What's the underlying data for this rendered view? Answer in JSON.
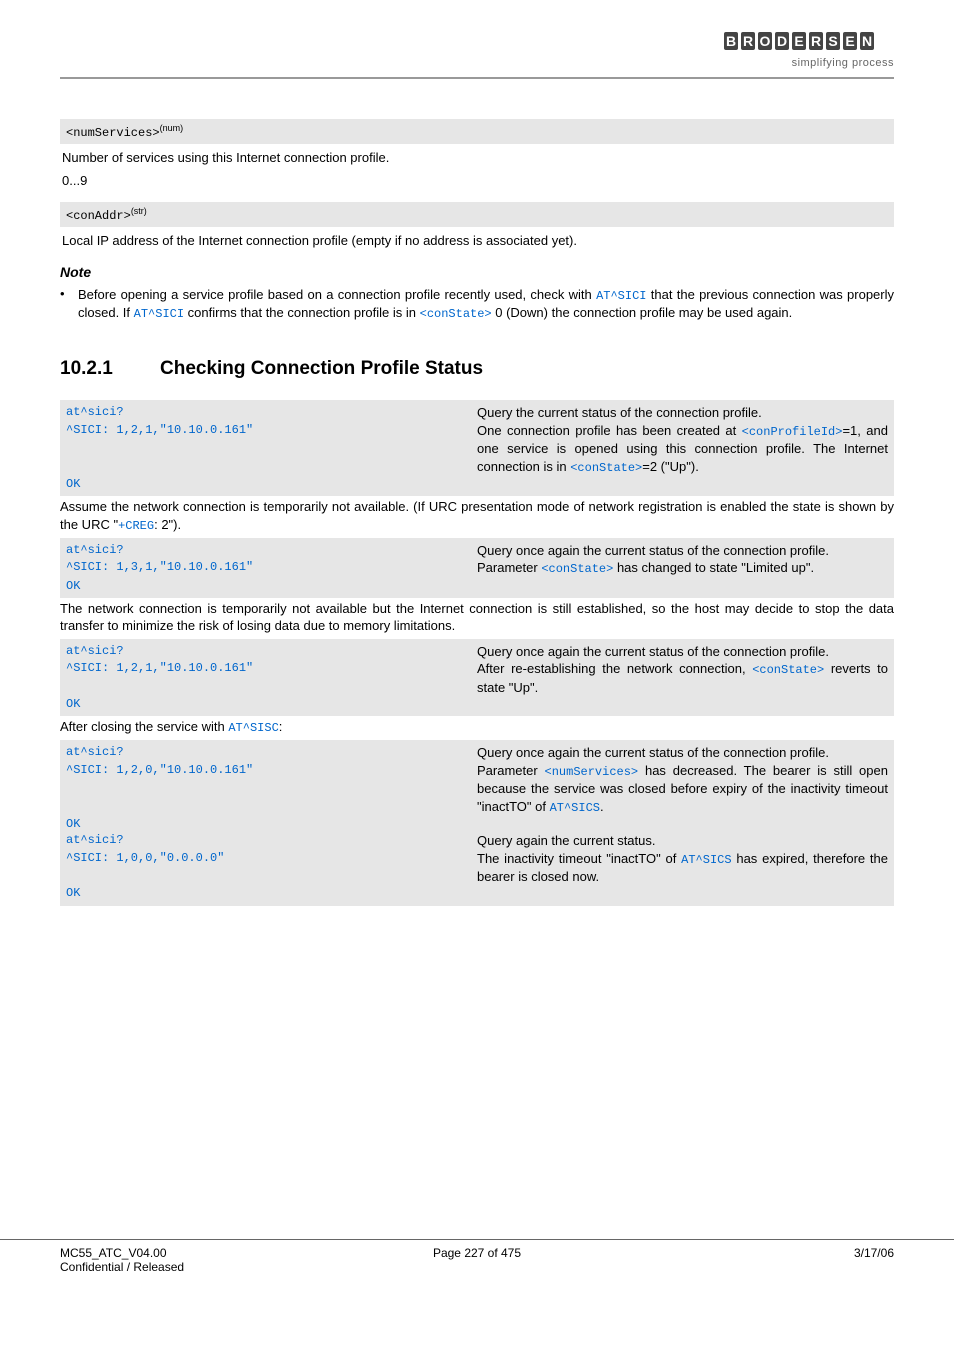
{
  "header": {
    "logo_alt": "BRODERSEN",
    "logo_sub": "simplifying process"
  },
  "param1": {
    "name": "<numServices>",
    "type": "(num)",
    "desc": "Number of services using this Internet connection profile.",
    "range": "0...9"
  },
  "param2": {
    "name": "<conAddr>",
    "type": "(str)",
    "desc": "Local IP address of the Internet connection profile (empty if no address is associated yet)."
  },
  "note": {
    "title": "Note",
    "bullet_pre": "Before opening a service profile based on a connection profile recently used, check with ",
    "ref1": "AT^SICI",
    "bullet_mid1": " that the previous connection was properly closed. If ",
    "ref2": "AT^SICI",
    "bullet_mid2": " confirms that the connection profile is in ",
    "ref3": "<conState>",
    "bullet_end": " 0 (Down) the connection profile may be used again."
  },
  "section": {
    "num": "10.2.1",
    "title": "Checking Connection Profile Status"
  },
  "ex1": {
    "l1": "at^sici?",
    "l2": "^SICI: 1,2,1,\"10.10.0.161\"",
    "r1": "Query the current status of the connection profile.",
    "r2a": "One connection profile has been created at ",
    "r2b": "<conProfileId>",
    "r2c": "=1, and one service is opened using this connection profile. The Internet connection is in ",
    "r2d": "<conState>",
    "r2e": "=2 (\"Up\").",
    "ok": "OK"
  },
  "body1a": "Assume the network connection is temporarily not available. (If URC presentation mode of network registration is enabled the state is shown by the URC \"",
  "body1ref": "+CREG",
  "body1b": ": 2\").",
  "ex2": {
    "l1": "at^sici?",
    "l2": "^SICI: 1,3,1,\"10.10.0.161\"",
    "r1": "Query once again the current status of the connection profile.",
    "r2a": "Parameter ",
    "r2b": "<conState>",
    "r2c": " has changed to state \"Limited up\".",
    "ok": "OK"
  },
  "body2": "The network connection is temporarily not available but the Internet connection is still established, so the host may decide to stop the data transfer to minimize the risk of losing data due to memory limitations.",
  "ex3": {
    "l1": "at^sici?",
    "l2": "^SICI: 1,2,1,\"10.10.0.161\"",
    "r1": "Query once again the current status of the connection profile.",
    "r2a": "After re-establishing the network connection, ",
    "r2b": "<conState>",
    "r2c": " reverts to state \"Up\".",
    "ok": "OK"
  },
  "body3a": "After closing the service with ",
  "body3ref": "AT^SISC",
  "body3b": ":",
  "ex4": {
    "l1": "at^sici?",
    "l2": "^SICI: 1,2,0,\"10.10.0.161\"",
    "r1": "Query once again the current status of the connection profile.",
    "r2a": "Parameter ",
    "r2b": "<numServices>",
    "r2c": " has decreased. The bearer is still open because the service was closed before expiry of the inactivity timeout \"inactTO\" of ",
    "r2d": "AT^SICS",
    "r2e": ".",
    "ok1": "OK",
    "l3": "at^sici?",
    "l4": "^SICI: 1,0,0,\"0.0.0.0\"",
    "r3": "Query again the current status.",
    "r4a": "The inactivity timeout \"inactTO\" of ",
    "r4b": "AT^SICS",
    "r4c": " has expired, therefore the bearer is closed now.",
    "ok2": "OK"
  },
  "footer": {
    "left1": "MC55_ATC_V04.00",
    "left2": "Confidential / Released",
    "center": "Page 227 of 475",
    "right": "3/17/06"
  }
}
